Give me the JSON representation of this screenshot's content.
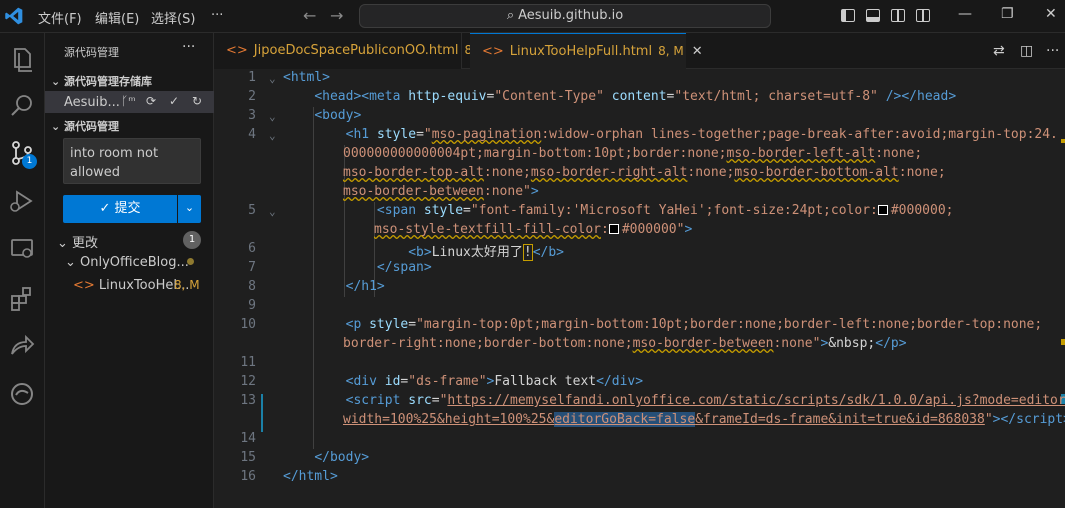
{
  "titlebar": {
    "menus": [
      "文件(F)",
      "编辑(E)",
      "选择(S)",
      "···"
    ],
    "search_text": "Aesuib.github.io"
  },
  "sidebar": {
    "title": "源代码管理",
    "repos_section": "源代码管理存储库",
    "repo_name": "Aesuib...",
    "scm_section": "源代码管理",
    "commit_message": "into room not allowed",
    "commit_button": "提交",
    "changes_label": "更改",
    "changes_count": "1",
    "folder_name": "OnlyOfficeBlog...",
    "file_name": "LinuxTooHel...",
    "file_status": "8, M",
    "activity_badge": "1"
  },
  "tabs": [
    {
      "label": "JipoeDocSpacePubliconOO.html",
      "meta": "8"
    },
    {
      "label": "LinuxTooHelpFull.html",
      "meta": "8, M"
    }
  ],
  "editor": {
    "line_numbers": [
      "1",
      "2",
      "3",
      "4",
      "",
      "",
      "",
      "5",
      "",
      "6",
      "7",
      "8",
      "9",
      "10",
      "",
      "11",
      "12",
      "13",
      "",
      "14",
      "15",
      "16"
    ],
    "colors": {
      "tag": "#569cd6",
      "attr": "#9cdcfe",
      "string": "#ce9178",
      "accent": "#0078d4"
    }
  }
}
